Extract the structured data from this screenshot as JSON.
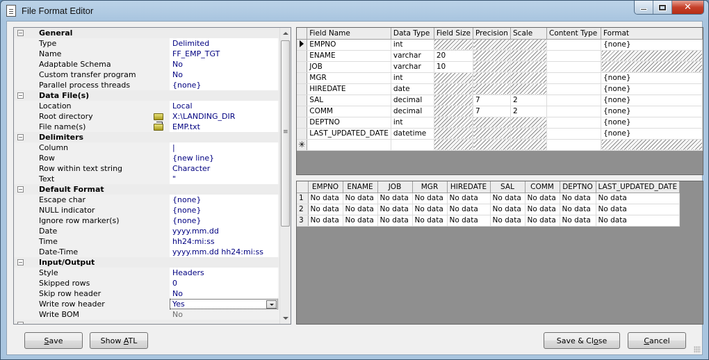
{
  "window": {
    "title": "File Format Editor",
    "controls": {
      "minimize": "minimize",
      "maximize": "maximize",
      "close": "✕"
    }
  },
  "properties": {
    "categories": [
      {
        "label": "General",
        "items": [
          {
            "label": "Type",
            "value": "Delimited"
          },
          {
            "label": "Name",
            "value": "FF_EMP_TGT"
          },
          {
            "label": "Adaptable Schema",
            "value": "No"
          },
          {
            "label": "Custom transfer program",
            "value": "No"
          },
          {
            "label": "Parallel process threads",
            "value": "{none}"
          }
        ]
      },
      {
        "label": "Data File(s)",
        "items": [
          {
            "label": "Location",
            "value": "Local"
          },
          {
            "label": "Root directory",
            "value": "X:\\LANDING_DIR",
            "icon": "folder-open-icon"
          },
          {
            "label": "File name(s)",
            "value": "EMP.txt",
            "icon": "folder-browse-icon"
          }
        ]
      },
      {
        "label": "Delimiters",
        "items": [
          {
            "label": "Column",
            "value": "|"
          },
          {
            "label": "Row",
            "value": "{new line}"
          },
          {
            "label": "Row within text string",
            "value": "Character"
          },
          {
            "label": "Text",
            "value": "\""
          }
        ]
      },
      {
        "label": "Default Format",
        "items": [
          {
            "label": "Escape char",
            "value": "{none}"
          },
          {
            "label": "NULL indicator",
            "value": "{none}"
          },
          {
            "label": "Ignore row marker(s)",
            "value": "{none}"
          },
          {
            "label": "Date",
            "value": "yyyy.mm.dd"
          },
          {
            "label": "Time",
            "value": "hh24:mi:ss"
          },
          {
            "label": "Date-Time",
            "value": "yyyy.mm.dd hh24:mi:ss"
          }
        ]
      },
      {
        "label": "Input/Output",
        "items": [
          {
            "label": "Style",
            "value": "Headers"
          },
          {
            "label": "Skipped rows",
            "value": "0"
          },
          {
            "label": "Skip row header",
            "value": "No"
          },
          {
            "label": "Write row header",
            "value": "Yes",
            "editing": true
          },
          {
            "label": "Write BOM",
            "value": "No",
            "disabled": true
          }
        ]
      }
    ]
  },
  "schema": {
    "columns": [
      "Field Name",
      "Data Type",
      "Field Size",
      "Precision",
      "Scale",
      "Content Type",
      "Format"
    ],
    "rows": [
      {
        "current": true,
        "cells": [
          "EMPNO",
          "int",
          null,
          null,
          null,
          "",
          "{none}"
        ]
      },
      {
        "cells": [
          "ENAME",
          "varchar",
          "20",
          null,
          null,
          "",
          null
        ]
      },
      {
        "cells": [
          "JOB",
          "varchar",
          "10",
          null,
          null,
          "",
          null
        ]
      },
      {
        "cells": [
          "MGR",
          "int",
          null,
          null,
          null,
          "",
          "{none}"
        ]
      },
      {
        "cells": [
          "HIREDATE",
          "date",
          null,
          null,
          null,
          "",
          "{none}"
        ]
      },
      {
        "cells": [
          "SAL",
          "decimal",
          null,
          "7",
          "2",
          "",
          "{none}"
        ]
      },
      {
        "cells": [
          "COMM",
          "decimal",
          null,
          "7",
          "2",
          "",
          "{none}"
        ]
      },
      {
        "cells": [
          "DEPTNO",
          "int",
          null,
          null,
          null,
          "",
          "{none}"
        ]
      },
      {
        "cells": [
          "LAST_UPDATED_DATE",
          "datetime",
          null,
          null,
          null,
          "",
          "{none}"
        ]
      }
    ],
    "new_row_marker": "✳"
  },
  "preview": {
    "columns": [
      "EMPNO",
      "ENAME",
      "JOB",
      "MGR",
      "HIREDATE",
      "SAL",
      "COMM",
      "DEPTNO",
      "LAST_UPDATED_DATE"
    ],
    "rows": [
      {
        "num": "1",
        "cells": [
          "No data",
          "No data",
          "No data",
          "No data",
          "No data",
          "No data",
          "No data",
          "No data",
          "No data"
        ]
      },
      {
        "num": "2",
        "cells": [
          "No data",
          "No data",
          "No data",
          "No data",
          "No data",
          "No data",
          "No data",
          "No data",
          "No data"
        ]
      },
      {
        "num": "3",
        "cells": [
          "No data",
          "No data",
          "No data",
          "No data",
          "No data",
          "No data",
          "No data",
          "No data",
          "No data"
        ]
      }
    ]
  },
  "buttons": {
    "save": {
      "label": "Save",
      "mnemonic": "S"
    },
    "show_atl": {
      "label": "Show ATL",
      "mnemonic": "A"
    },
    "save_close": {
      "label": "Save & Close",
      "mnemonic": "o"
    },
    "cancel": {
      "label": "Cancel",
      "mnemonic": "C"
    }
  }
}
